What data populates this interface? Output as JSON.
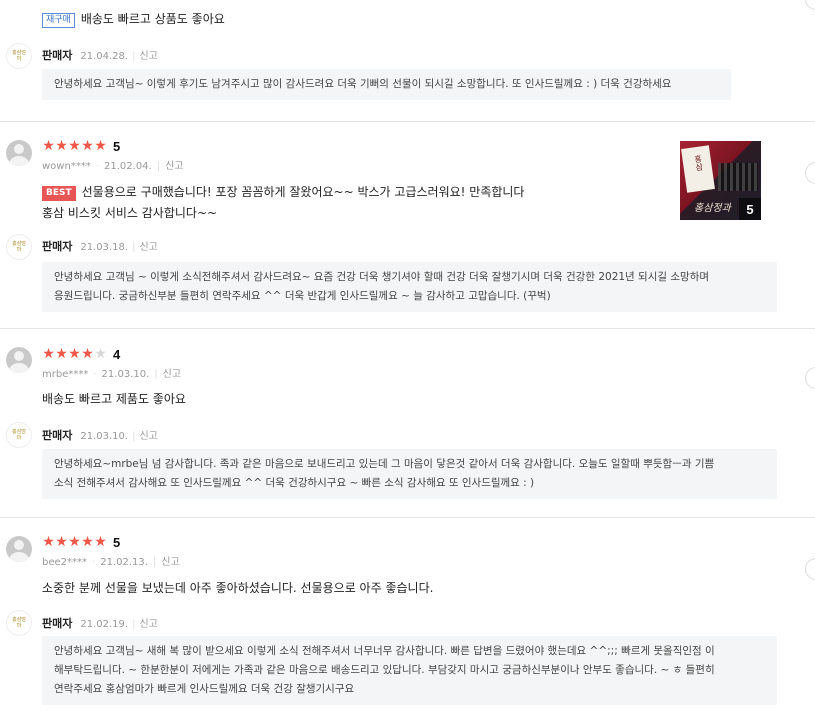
{
  "reviews": [
    {
      "tag": "재구매",
      "text_lines": [
        "배송도 빠르고 상품도 좋아요"
      ],
      "reply": {
        "seller": "판매자",
        "date": "21.04.28.",
        "report": "신고",
        "lines": [
          "안녕하세요 고객님~ 이렇게 후기도 남겨주시고 많이 감사드려요 더욱 기뻐의 선물이 되시길 소망합니다. 또 인사드릴께요 : ) 더욱 건강하세요"
        ]
      }
    },
    {
      "rating_stars": 5,
      "score": "5",
      "user": "wown****",
      "date": "21.02.04.",
      "report": "신고",
      "tag": "BEST",
      "text_lines": [
        "선물용으로 구매했습니다! 포장 꼼꼼하게 잘왔어요~~ 박스가 고급스러워요! 만족합니다",
        "홍삼 비스킷 서비스 감사합니다~~"
      ],
      "photo": {
        "count": "5",
        "caption": "홍삼정과",
        "card_text": "홍삼"
      },
      "reply": {
        "seller": "판매자",
        "date": "21.03.18.",
        "report": "신고",
        "lines": [
          "안녕하세요 고객님 ~ 이렇게 소식전해주셔서 감사드려요~ 요즘 건강 더욱 챙기셔야 할때 건강 더욱 잘챙기시며 더욱 건강한 2021년 되시길 소망하며",
          "응원드립니다. 궁금하신부분 들편히 연락주세요 ^^ 더욱 반갑게 인사드릴께요 ~ 늘 감사하고 고맙습니다. (꾸벅)"
        ]
      }
    },
    {
      "rating_stars": 4,
      "score": "4",
      "user": "mrbe****",
      "date": "21.03.10.",
      "report": "신고",
      "text_lines": [
        "배송도 빠르고 제품도 좋아요"
      ],
      "reply": {
        "seller": "판매자",
        "date": "21.03.10.",
        "report": "신고",
        "lines": [
          "안녕하세요~mrbe님 넘 감사합니다. 족과 같은 마음으로 보내드리고 있는데 그 마음이 닿은것 같아서 더욱 감사합니다. 오늘도 일할때 뿌듯함ㅡ과 기쁨",
          "소식 전해주셔서 감사해요 또 인사드릴께요 ^^ 더욱 건강하시구요 ~ 빠른 소식 감사해요 또 인사드릴께요 : )"
        ]
      }
    },
    {
      "rating_stars": 5,
      "score": "5",
      "user": "bee2****",
      "date": "21.02.13.",
      "report": "신고",
      "text_lines": [
        "소중한 분께 선물을 보냈는데 아주 좋아하셨습니다. 선물용으로 아주 좋습니다."
      ],
      "reply": {
        "seller": "판매자",
        "date": "21.02.19.",
        "report": "신고",
        "lines": [
          "안녕하세요 고객님~ 새해 복 많이 받으세요 이렇게 소식 전해주셔서 너무너무 감사합니다. 빠른 답변을 드렸어야 했는데요 ^^;;; 빠르게 못올직인점 이",
          "해부탁드립니다. ~ 한분한분이 저에게는 가족과 같은 마음으로 배송드리고 있답니다. 부담갖지 마시고 궁금하신부분이나 안부도 좋습니다. ~ ㅎ 들편히",
          "연락주세요 홍삼엄마가 빠르게 인사드릴께요 더욱 건강 잘챙기시구요"
        ]
      }
    }
  ],
  "seller_logo_text": "홍삼엄마"
}
